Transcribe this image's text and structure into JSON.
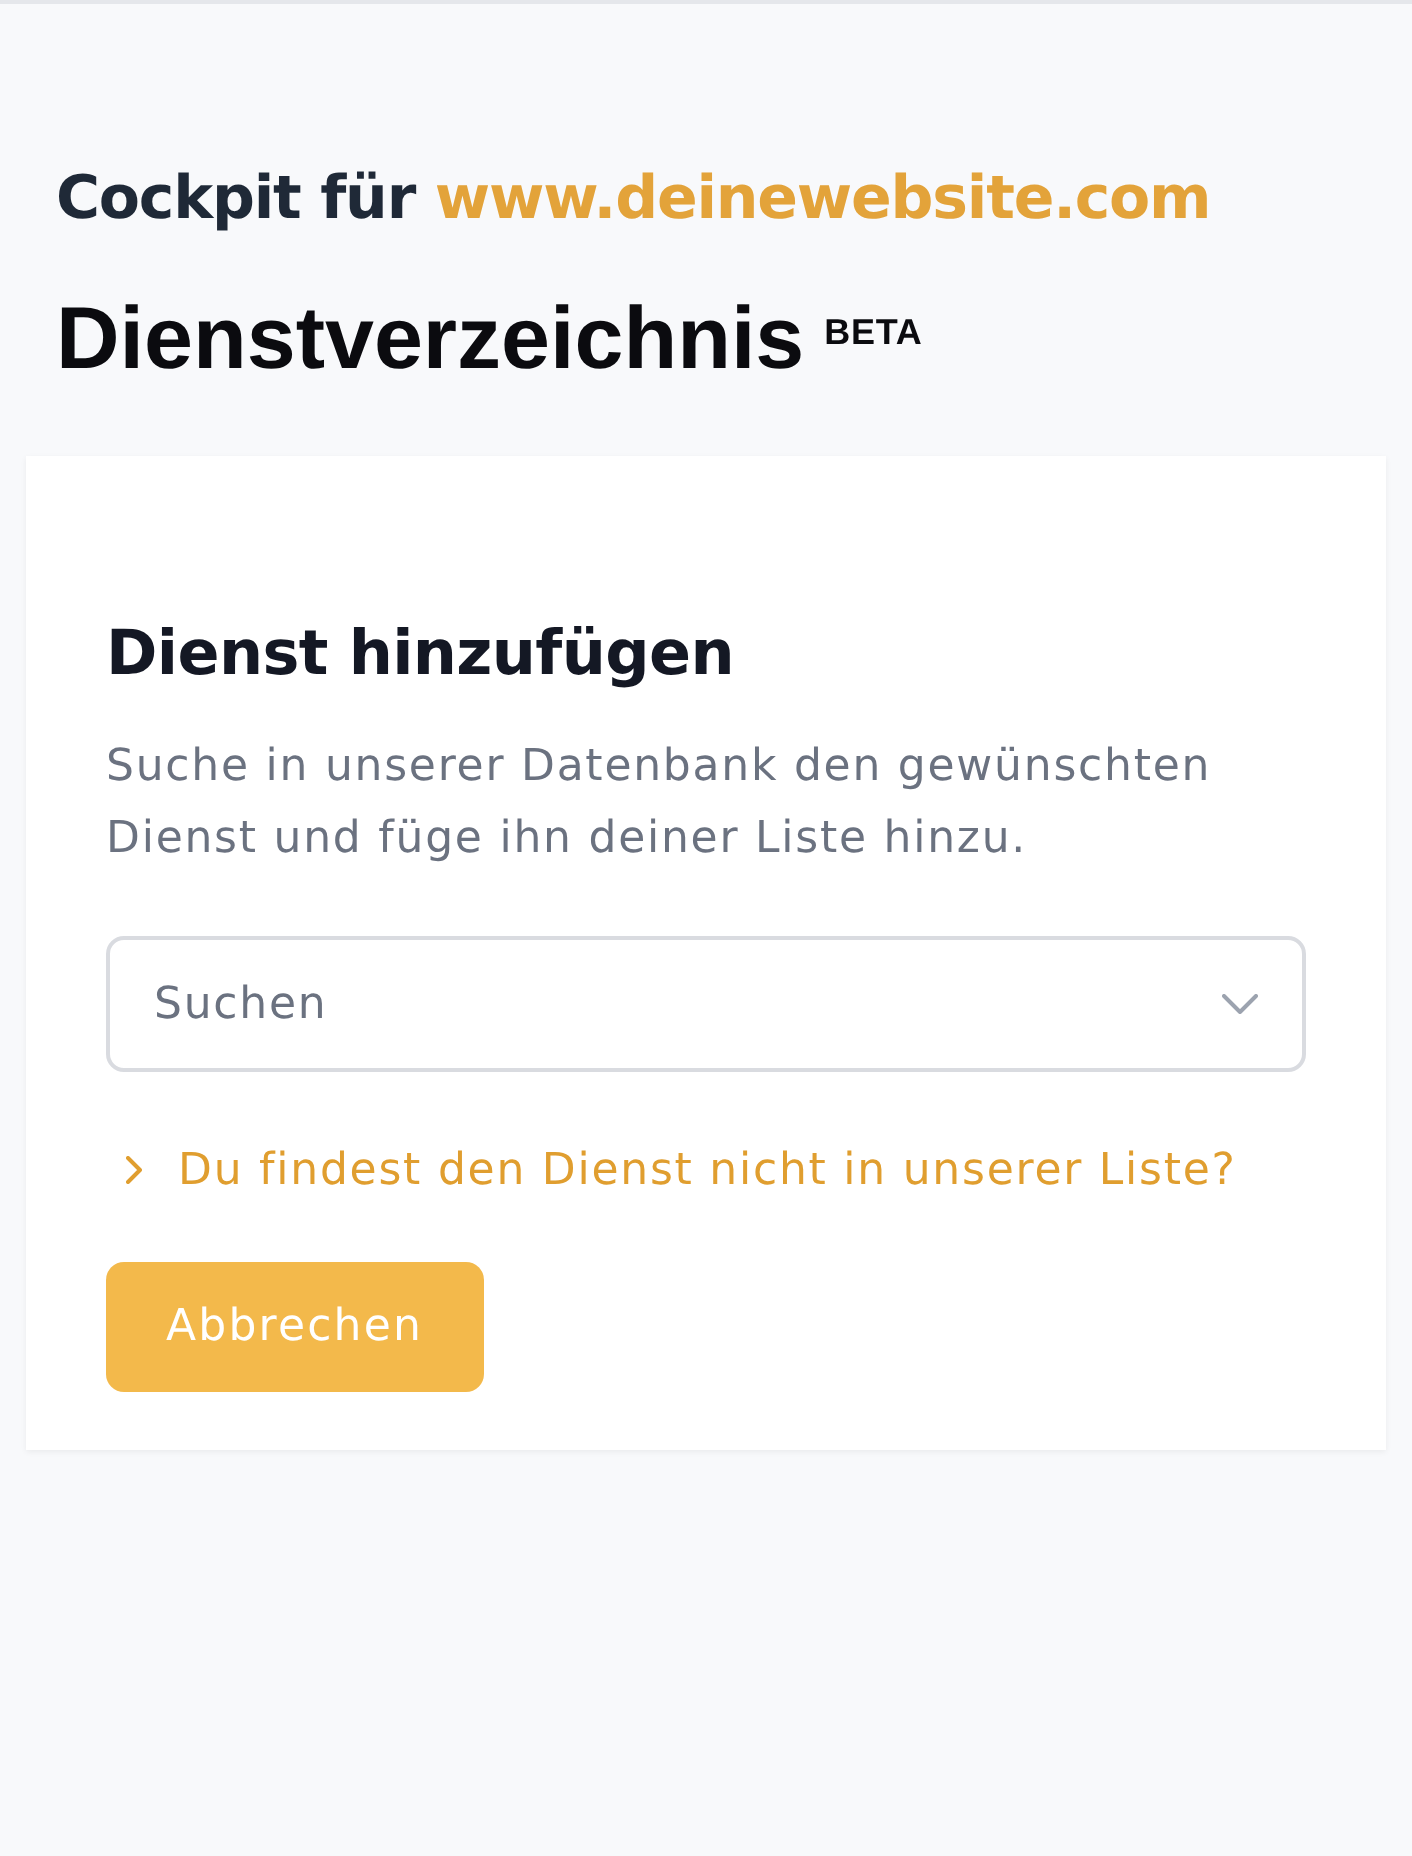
{
  "header": {
    "prefix": "Cockpit für",
    "site": "www.deinewebsite.com"
  },
  "page_title": {
    "text": "Dienstverzeichnis",
    "badge": "BETA"
  },
  "card": {
    "title": "Dienst hinzufügen",
    "description": "Suche in unserer Datenbank den gewünschten Dienst und füge ihn deiner Liste hinzu.",
    "search": {
      "placeholder": "Suchen"
    },
    "link": {
      "label": "Du findest den Dienst nicht in unserer Liste?",
      "expanded": false
    },
    "buttons": [
      {
        "label": "Abbrechen"
      }
    ]
  }
}
